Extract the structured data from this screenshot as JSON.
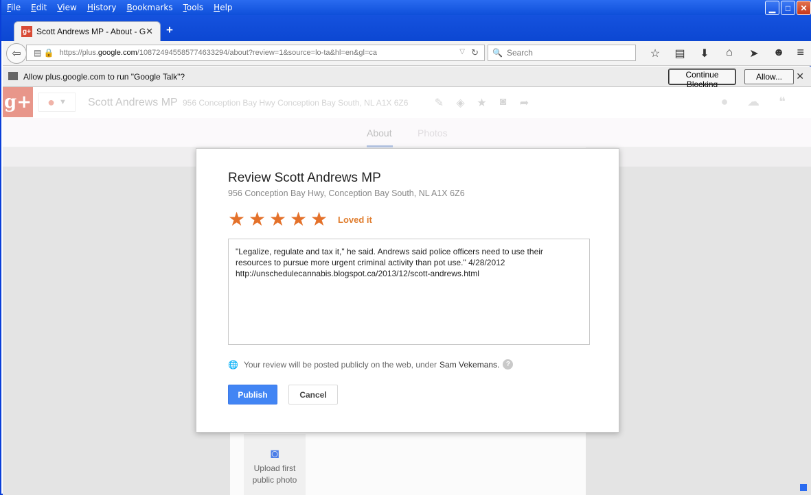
{
  "menubar": {
    "items": [
      "File",
      "Edit",
      "View",
      "History",
      "Bookmarks",
      "Tools",
      "Help"
    ],
    "accelerators": [
      "F",
      "E",
      "V",
      "H",
      "B",
      "T",
      "H"
    ]
  },
  "tab": {
    "title": "Scott Andrews MP - About - G...",
    "favicon": "g+"
  },
  "navbar": {
    "url_prefix": "https://plus.",
    "url_domain": "google.com",
    "url_rest": "/108724945585774633294/about?review=1&source=lo-ta&hl=en&gl=ca",
    "search_placeholder": "Search"
  },
  "notification": {
    "message": "Allow plus.google.com to run \"Google Talk\"?",
    "continue_blocking": "Continue Blocking",
    "allow": "Allow..."
  },
  "gplus": {
    "logo": "g+",
    "place_name": "Scott Andrews MP",
    "place_address": "956 Conception Bay Hwy Conception Bay South, NL A1X 6Z6",
    "tabs": {
      "about": "About",
      "photos": "Photos"
    },
    "upload": {
      "line1": "Upload first",
      "line2": "public photo"
    }
  },
  "dialog": {
    "title": "Review Scott Andrews MP",
    "address": "956 Conception Bay Hwy, Conception Bay South, NL A1X 6Z6",
    "rating": 5,
    "rating_max": 5,
    "rating_label": "Loved it",
    "review_text": "\"Legalize, regulate and tax it,\" he said. Andrews said police officers need to use their\nresources to pursue more urgent criminal activity than pot use.\" 4/28/2012\nhttp://unschedulecannabis.blogspot.ca/2013/12/scott-andrews.html",
    "notice_text": "Your review will be posted publicly on the web, under",
    "user_name": "Sam Vekemans.",
    "publish_label": "Publish",
    "cancel_label": "Cancel"
  },
  "colors": {
    "star": "#e4712a",
    "rating_label": "#e07d2e",
    "publish_bg": "#4285f4",
    "titlebar": "#0e4fd9"
  }
}
